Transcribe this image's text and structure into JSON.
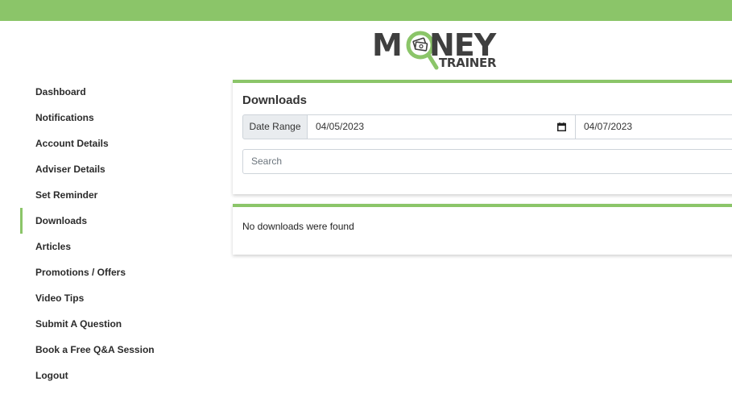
{
  "header": {
    "logo": {
      "word_start": "M",
      "word_end": "NEY",
      "subtitle": "TRAINER",
      "icon": "magnifier-money-icon"
    }
  },
  "colors": {
    "accent": "#8bc569",
    "text": "#2b2b2b",
    "input_border": "#ced4da",
    "addon_bg": "#e9ecef"
  },
  "sidebar": {
    "items": [
      {
        "label": "Dashboard"
      },
      {
        "label": "Notifications"
      },
      {
        "label": "Account Details"
      },
      {
        "label": "Adviser Details"
      },
      {
        "label": "Set Reminder"
      },
      {
        "label": "Downloads",
        "active": true
      },
      {
        "label": "Articles"
      },
      {
        "label": "Promotions / Offers"
      },
      {
        "label": "Video Tips"
      },
      {
        "label": "Submit A Question"
      },
      {
        "label": "Book a Free Q&A Session"
      },
      {
        "label": "Logout"
      }
    ]
  },
  "main": {
    "title": "Downloads",
    "date_range": {
      "label": "Date Range",
      "from": "04/05/2023",
      "to": "04/07/2023",
      "icon": "calendar-icon"
    },
    "search": {
      "placeholder": "Search",
      "value": ""
    },
    "results": {
      "empty_message": "No downloads were found"
    }
  }
}
